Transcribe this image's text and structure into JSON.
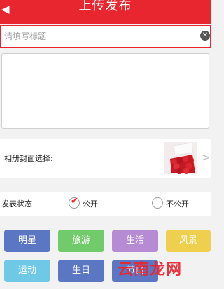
{
  "header": {
    "title": "上传发布",
    "back_icon": "back-arrow-icon"
  },
  "title_field": {
    "placeholder": "请填写标题",
    "value": "",
    "clear_icon": "close-icon"
  },
  "content": {
    "value": ""
  },
  "cover": {
    "label": "相册封面选择:",
    "arrow_icon": "chevron-right-icon"
  },
  "status": {
    "label": "发表状态",
    "options": [
      {
        "label": "公开",
        "selected": true
      },
      {
        "label": "不公开",
        "selected": false
      }
    ]
  },
  "tags": [
    {
      "label": "明星",
      "color": "#5b77c4"
    },
    {
      "label": "旅游",
      "color": "#72cb6a"
    },
    {
      "label": "生活",
      "color": "#b78bd4"
    },
    {
      "label": "风景",
      "color": "#efcf4e"
    },
    {
      "label": "运动",
      "color": "#6ec8e6"
    },
    {
      "label": "生日",
      "color": "#5b77c4"
    },
    {
      "label": "节日",
      "color": "#5b77c4"
    }
  ],
  "watermark": "云南龙网",
  "colors": {
    "accent": "#e8262f"
  }
}
